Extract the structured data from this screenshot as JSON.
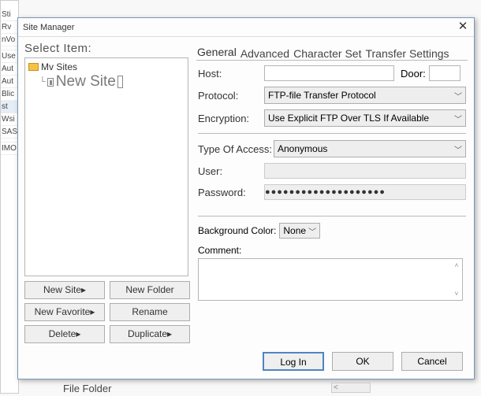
{
  "background_sidebar": [
    "Sti",
    "Rv",
    "nVo",
    "Use",
    "Aut",
    "Aut",
    "Blic",
    "st",
    "Wsi",
    "SAS",
    "IMO"
  ],
  "dialog_title": "Site Manager",
  "left": {
    "heading": "Select Item:",
    "root_folder": "Mv Sites",
    "child_site": "New Site",
    "buttons": {
      "new_site": "New Site▸",
      "new_folder": "New Folder",
      "new_favorite": "New Favorite▸",
      "rename": "Rename",
      "delete": "Delete▸",
      "duplicate": "Duplicate▸"
    }
  },
  "tabs": [
    "General",
    "Advanced",
    "Character Set",
    "Transfer Settings"
  ],
  "form": {
    "host_label": "Host:",
    "door_label": "Door:",
    "protocol_label": "Protocol:",
    "protocol_value": "FTP-file Transfer Protocol",
    "encryption_label": "Encryption:",
    "encryption_value": "Use Explicit FTP Over TLS If Available",
    "access_label": "Type Of Access:",
    "access_value": "Anonymous",
    "user_label": "User:",
    "password_label": "Password:",
    "password_value": "●●●●●●●●●●●●●●●●●●●●",
    "bgcolor_label": "Background Color:",
    "bgcolor_value": "None",
    "comment_label": "Comment:"
  },
  "bottom": {
    "login": "Log In",
    "ok": "OK",
    "cancel": "Cancel"
  },
  "folder_row_text": "File Folder"
}
